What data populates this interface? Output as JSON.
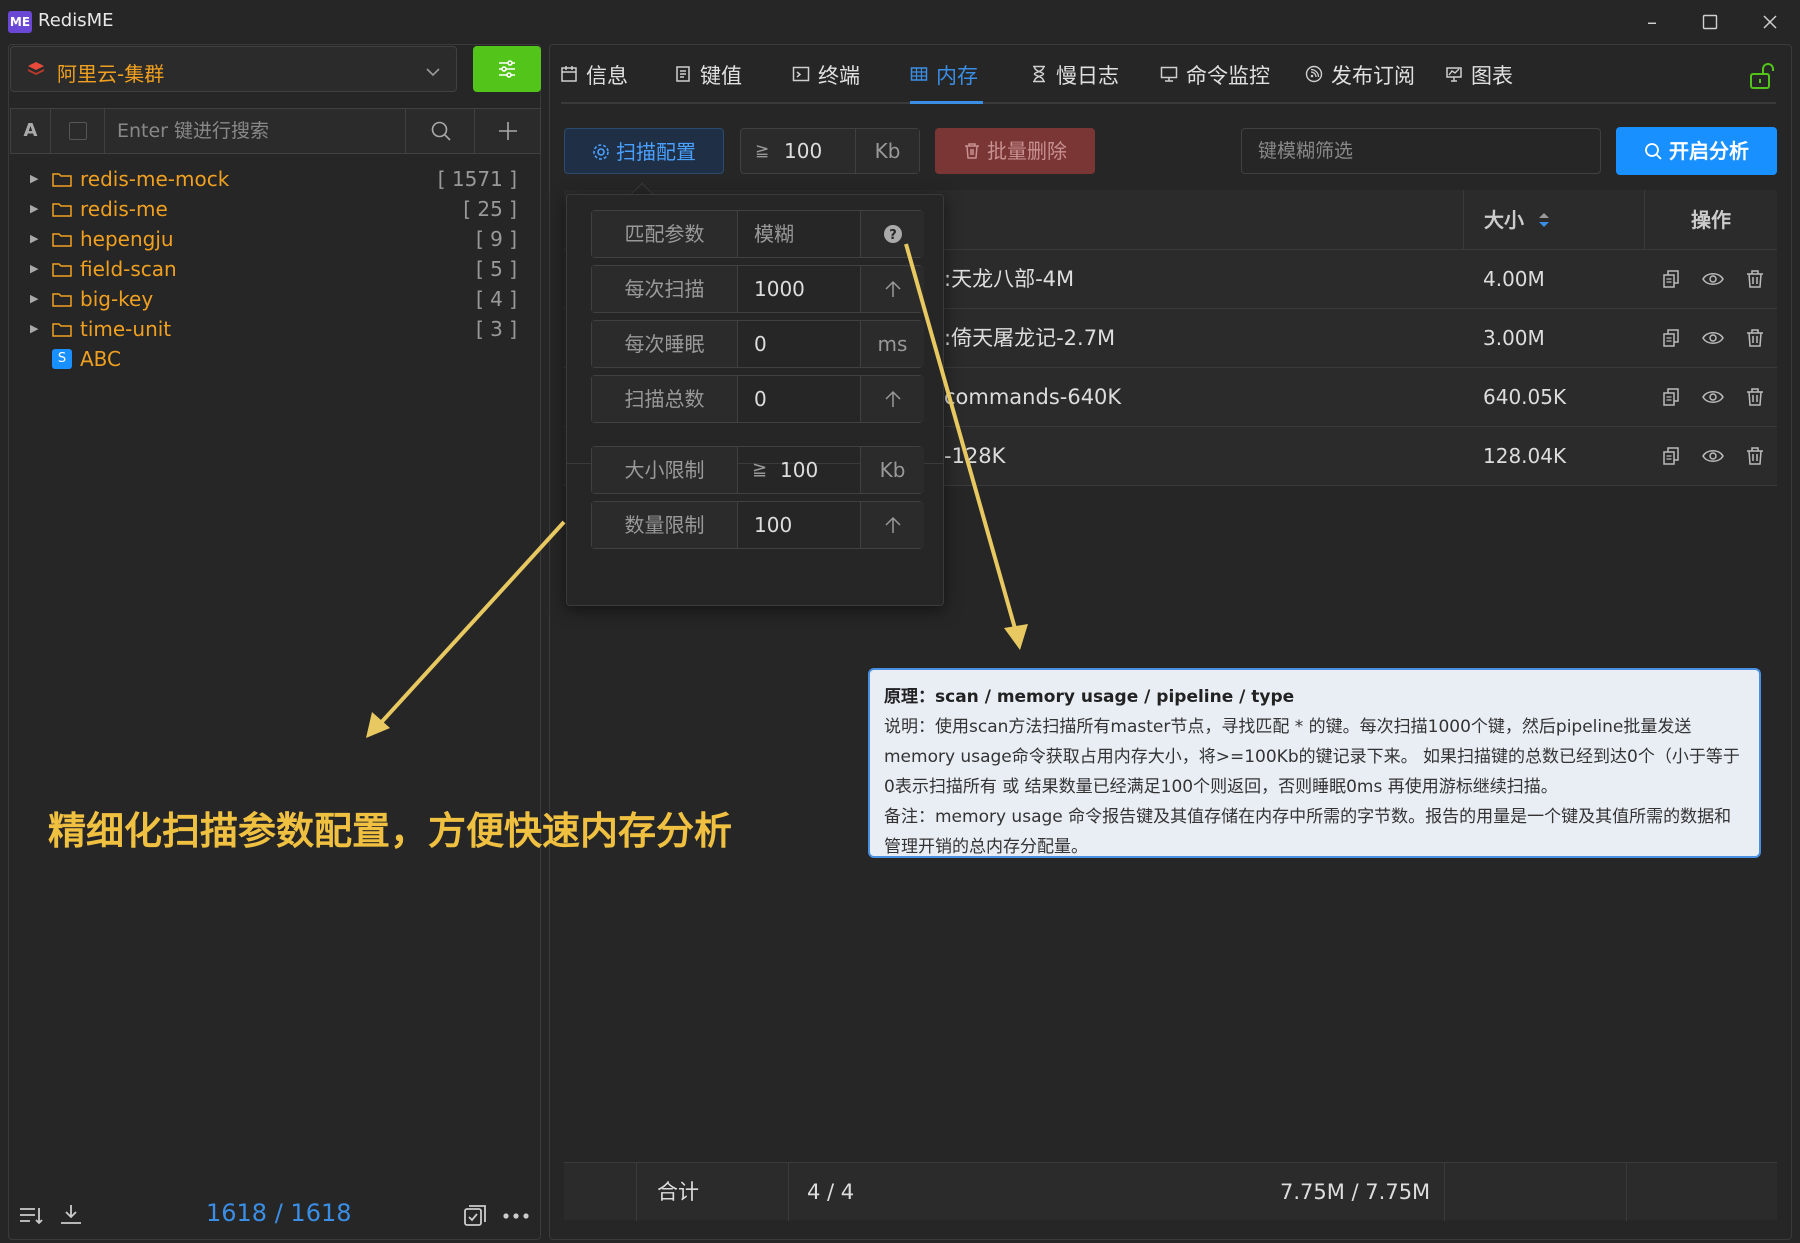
{
  "window": {
    "title": "RedisME",
    "logo": "ME"
  },
  "connection": {
    "name": "阿里云-集群",
    "icon": "redis-icon"
  },
  "left_panel": {
    "search_type_label": "A",
    "search_placeholder": "Enter 键进行搜索",
    "tree": [
      {
        "name": "redis-me-mock",
        "count": "[ 1571 ]",
        "type": "folder"
      },
      {
        "name": "redis-me",
        "count": "[ 25 ]",
        "type": "folder"
      },
      {
        "name": "hepengju",
        "count": "[ 9 ]",
        "type": "folder"
      },
      {
        "name": "field-scan",
        "count": "[ 5 ]",
        "type": "folder"
      },
      {
        "name": "big-key",
        "count": "[ 4 ]",
        "type": "folder"
      },
      {
        "name": "time-unit",
        "count": "[ 3 ]",
        "type": "folder"
      },
      {
        "name": "ABC",
        "badge": "S",
        "type": "string"
      }
    ],
    "footer_count": "1618 / 1618"
  },
  "tabs": [
    {
      "label": "信息",
      "icon": "calendar-icon"
    },
    {
      "label": "键值",
      "icon": "document-icon"
    },
    {
      "label": "终端",
      "icon": "terminal-icon"
    },
    {
      "label": "内存",
      "icon": "table-icon",
      "active": true
    },
    {
      "label": "慢日志",
      "icon": "hourglass-icon"
    },
    {
      "label": "命令监控",
      "icon": "monitor-icon"
    },
    {
      "label": "发布订阅",
      "icon": "broadcast-icon"
    },
    {
      "label": "图表",
      "icon": "chart-icon"
    }
  ],
  "toolbar": {
    "scan_config": "扫描配置",
    "size_gte": "≧",
    "size_value": "100",
    "size_unit": "Kb",
    "batch_delete": "批量删除",
    "key_filter_placeholder": "键模糊筛选",
    "analyze": "开启分析"
  },
  "table": {
    "col_size": "大小",
    "col_ops": "操作",
    "rows": [
      {
        "key": ":天龙八部-4M",
        "size": "4.00M"
      },
      {
        "key": ":倚天屠龙记-2.7M",
        "size": "3.00M"
      },
      {
        "key": "commands-640K",
        "size": "640.05K"
      },
      {
        "key": "-128K",
        "size": "128.04K"
      }
    ],
    "footer": {
      "label": "合计",
      "count": "4 / 4",
      "size": "7.75M / 7.75M"
    }
  },
  "popover": {
    "rows": [
      {
        "label": "匹配参数",
        "value": "模糊",
        "suffix": "?"
      },
      {
        "label": "每次扫描",
        "value": "1000",
        "suffix": "↑"
      },
      {
        "label": "每次睡眠",
        "value": "0",
        "suffix": "ms"
      },
      {
        "label": "扫描总数",
        "value": "0",
        "suffix": "↑"
      },
      {
        "label": "大小限制",
        "prefix": "≧",
        "value": "100",
        "suffix": "Kb"
      },
      {
        "label": "数量限制",
        "value": "100",
        "suffix": "↑"
      }
    ]
  },
  "tooltip": {
    "title": "原理：scan / memory usage / pipeline / type",
    "line1": "说明：使用scan方法扫描所有master节点，寻找匹配 * 的键。每次扫描1000个键，然后pipeline批量发送memory usage命令获取占用内存大小，将>=100Kb的键记录下来。 如果扫描键的总数已经到达0个（小于等于0表示扫描所有 或 结果数量已经满足100个则返回，否则睡眠0ms 再使用游标继续扫描。",
    "line2": "备注：memory usage 命令报告键及其值存储在内存中所需的字节数。报告的用量是一个键及其值所需的数据和管理开销的总内存分配量。"
  },
  "annotation": "精细化扫描参数配置，方便快速内存分析",
  "colors": {
    "accent": "#1890ff",
    "folder": "#f0a020",
    "green": "#52c41a",
    "danger": "#7a3535",
    "annotation": "#f0c040"
  }
}
